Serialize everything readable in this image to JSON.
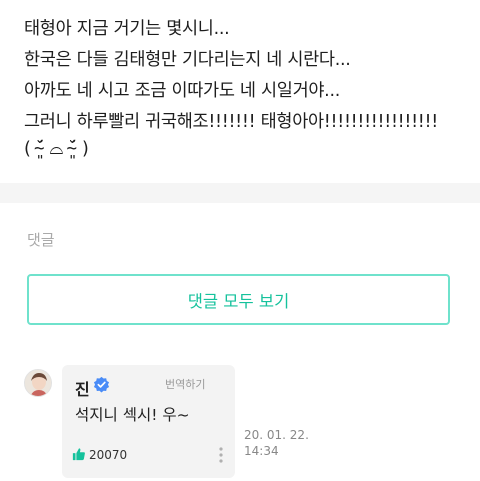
{
  "post": {
    "lines": [
      "태형아 지금 거기는 몇시니...",
      "한국은 다들 김태형만 기다리는지 네 시란다...",
      "아까도 네 시고 조금 이따가도 네 시일거야...",
      "그러니 하루빨리 귀국해조!!!!!!! 태형아아!!!!!!!!!!!!!!!!!",
      "( ˘̴͈́ ⌓ ˘̴͈́ )"
    ]
  },
  "comments": {
    "section_label": "댓글",
    "view_all_label": "댓글 모두 보기",
    "items": [
      {
        "author": "진",
        "verified": true,
        "translate_label": "번역하기",
        "text": "석지니 섹시! 우~",
        "likes": "20070",
        "date": "20. 01. 22.",
        "time": "14:34"
      }
    ]
  },
  "colors": {
    "accent": "#15c29c",
    "accent_border": "#6fe2cc",
    "verified": "#4a8cf7",
    "divider": "#f5f5f5",
    "bubble": "#f3f3f3"
  },
  "icons": [
    "verified-badge-icon",
    "thumbs-up-icon",
    "more-options-icon"
  ]
}
